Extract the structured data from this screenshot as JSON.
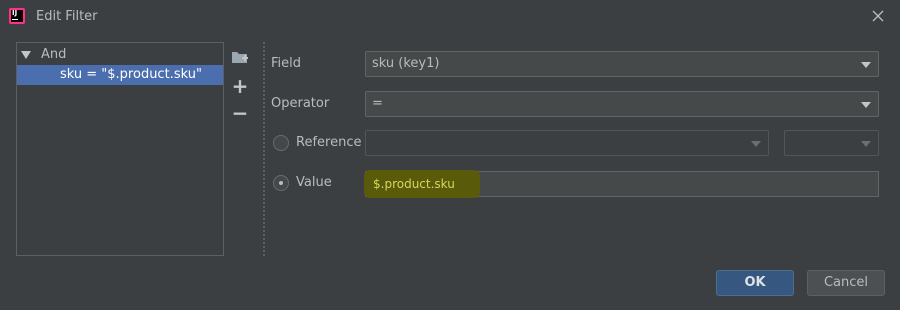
{
  "window": {
    "title": "Edit Filter"
  },
  "tree": {
    "root_label": "And",
    "child_label": "sku = \"$.product.sku\""
  },
  "toolbar": {
    "add_group_icon": "folder-add-icon",
    "add_icon": "plus-icon",
    "remove_icon": "minus-icon",
    "add_glyph": "+",
    "remove_glyph": "−"
  },
  "form": {
    "field_label": "Field",
    "field_value": "sku (key1)",
    "operator_label": "Operator",
    "operator_value": "=",
    "reference_label": "Reference",
    "reference_value": "",
    "reference_secondary_value": "",
    "value_label": "Value",
    "value_value": "$.product.sku",
    "selected_radio": "value"
  },
  "buttons": {
    "ok_label": "OK",
    "cancel_label": "Cancel"
  },
  "colors": {
    "background": "#3c3f41",
    "selection": "#4b6eaf",
    "ok_button": "#365880",
    "value_highlight": "#595b0a"
  }
}
